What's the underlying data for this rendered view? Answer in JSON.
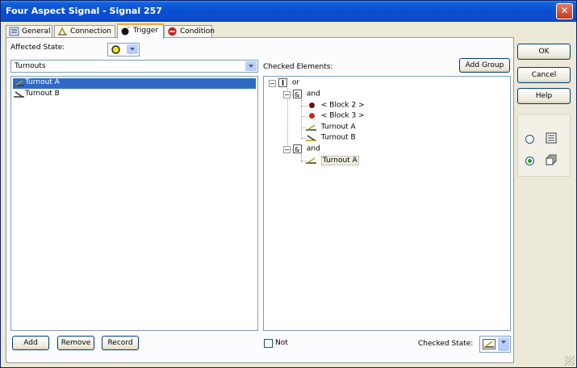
{
  "window": {
    "title": "Four Aspect Signal - Signal 257"
  },
  "tabs": [
    {
      "label": "General",
      "icon": "general-icon",
      "active": false
    },
    {
      "label": "Connection",
      "icon": "connection-icon",
      "active": false
    },
    {
      "label": "Trigger",
      "icon": "bomb-icon",
      "active": true
    },
    {
      "label": "Condition",
      "icon": "stop-sign-icon",
      "active": false
    }
  ],
  "affected_state": {
    "label": "Affected State:",
    "value_icon": "yellow-aspect-icon"
  },
  "element_type": {
    "value": "Turnouts"
  },
  "available_list": {
    "items": [
      {
        "label": "Turnout A",
        "icon": "turnout-icon",
        "selected": true
      },
      {
        "label": "Turnout B",
        "icon": "turnout-icon",
        "selected": false
      }
    ]
  },
  "checked_elements": {
    "label": "Checked Elements:",
    "add_group_label": "Add Group",
    "tree": {
      "root": "or",
      "group1": "and",
      "g1_items": [
        "< Block 2 >",
        "< Block 3 >",
        "Turnout A",
        "Turnout B"
      ],
      "group2": "and",
      "g2_items": [
        "Turnout A"
      ]
    }
  },
  "buttons": {
    "add": "Add",
    "remove": "Remove",
    "record": "Record",
    "ok": "OK",
    "cancel": "Cancel",
    "help": "Help"
  },
  "not_checkbox": {
    "label": "Not",
    "checked": false
  },
  "checked_state": {
    "label": "Checked State:",
    "value_icon": "turnout-icon"
  },
  "view_mode": {
    "selected": "icons"
  },
  "colors": {
    "accent": "#316ac5",
    "title_bar": "#0a4fd0",
    "tab_highlight": "#f3a63d"
  }
}
